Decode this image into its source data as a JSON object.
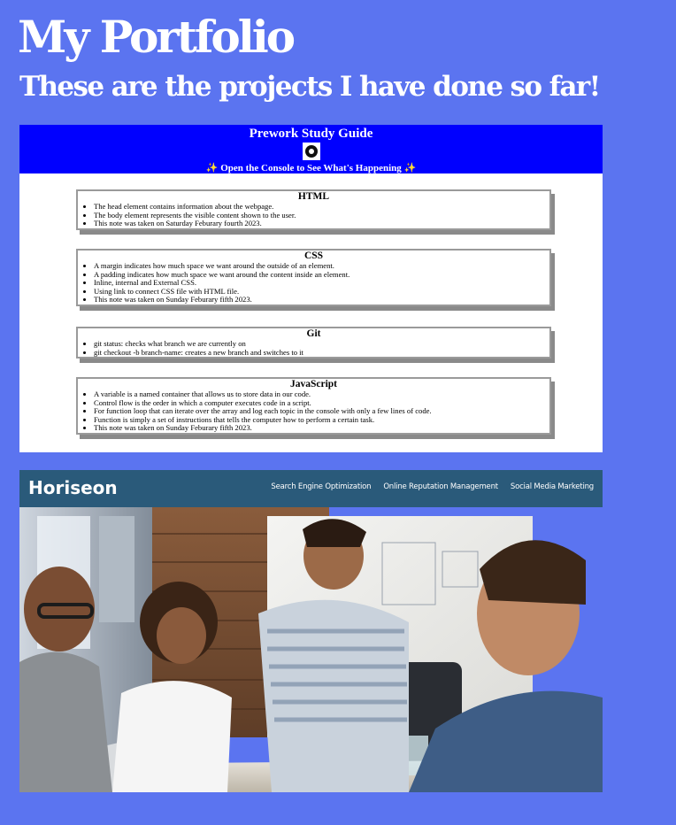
{
  "header": {
    "title": "My Portfolio",
    "subtitle": "These are the projects I have done so far!"
  },
  "projects": {
    "study_guide": {
      "title": "Prework Study Guide",
      "hint": "✨ Open the Console to See What's Happening ✨",
      "notes": [
        {
          "heading": "HTML",
          "items": [
            "The head element contains information about the webpage.",
            "The body element represents the visible content shown to the user.",
            "This note was taken on Saturday Feburary fourth 2023."
          ]
        },
        {
          "heading": "CSS",
          "items": [
            "A margin indicates how much space we want around the outside of an element.",
            "A padding indicates how much space we want around the content inside an element.",
            "Inline, internal and External CSS.",
            "Using link to connect CSS file with HTML file.",
            "This note was taken on Sunday Feburary fifth 2023."
          ]
        },
        {
          "heading": "Git",
          "items": [
            "git status: checks what branch we are currently on",
            "git checkout -b branch-name: creates a new branch and switches to it"
          ]
        },
        {
          "heading": "JavaScript",
          "items": [
            "A variable is a named container that allows us to store data in our code.",
            "Control flow is the order in which a computer executes code in a script.",
            "For function loop that can iterate over the array and log each topic in the console with only a few lines of code.",
            "Function is simply a set of instructions that tells the computer how to perform a certain task.",
            "This note was taken on Sunday Feburary fifth 2023."
          ]
        }
      ]
    },
    "horiseon": {
      "logo": "Horiseon",
      "nav": [
        "Search Engine Optimization",
        "Online Reputation Management",
        "Social Media Marketing"
      ]
    }
  },
  "colors": {
    "page_background": "#5b74f0",
    "study_guide_header": "#0000ff",
    "horiseon_header": "#2a5a7a"
  }
}
